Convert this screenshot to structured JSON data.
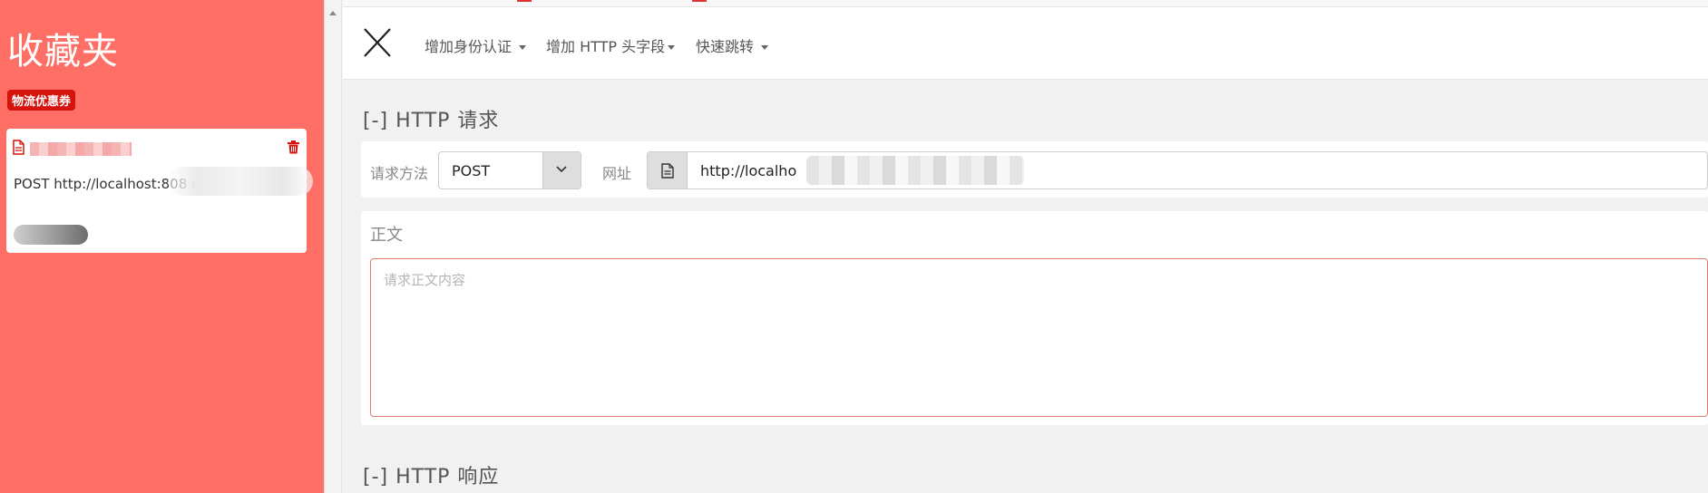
{
  "sidebar": {
    "title": "收藏夹",
    "tag": "物流优惠券",
    "favorites": [
      {
        "url": "POST http://localhost:808                ut"
      }
    ]
  },
  "toolbar": {
    "items": [
      {
        "label": "增加身份认证"
      },
      {
        "label": "增加 HTTP 头字段"
      },
      {
        "label": "快速跳转"
      }
    ]
  },
  "request": {
    "heading": "[-] HTTP 请求",
    "method_label": "请求方法",
    "method_value": "POST",
    "url_label": "网址",
    "url_value": "http://localho"
  },
  "body": {
    "label": "正文",
    "placeholder": "请求正文内容"
  },
  "response": {
    "heading": "[-] HTTP 响应"
  },
  "colors": {
    "sidebar_bg": "#ff6f66",
    "badge_bg": "#d6130d",
    "textarea_border": "#e07b74"
  }
}
